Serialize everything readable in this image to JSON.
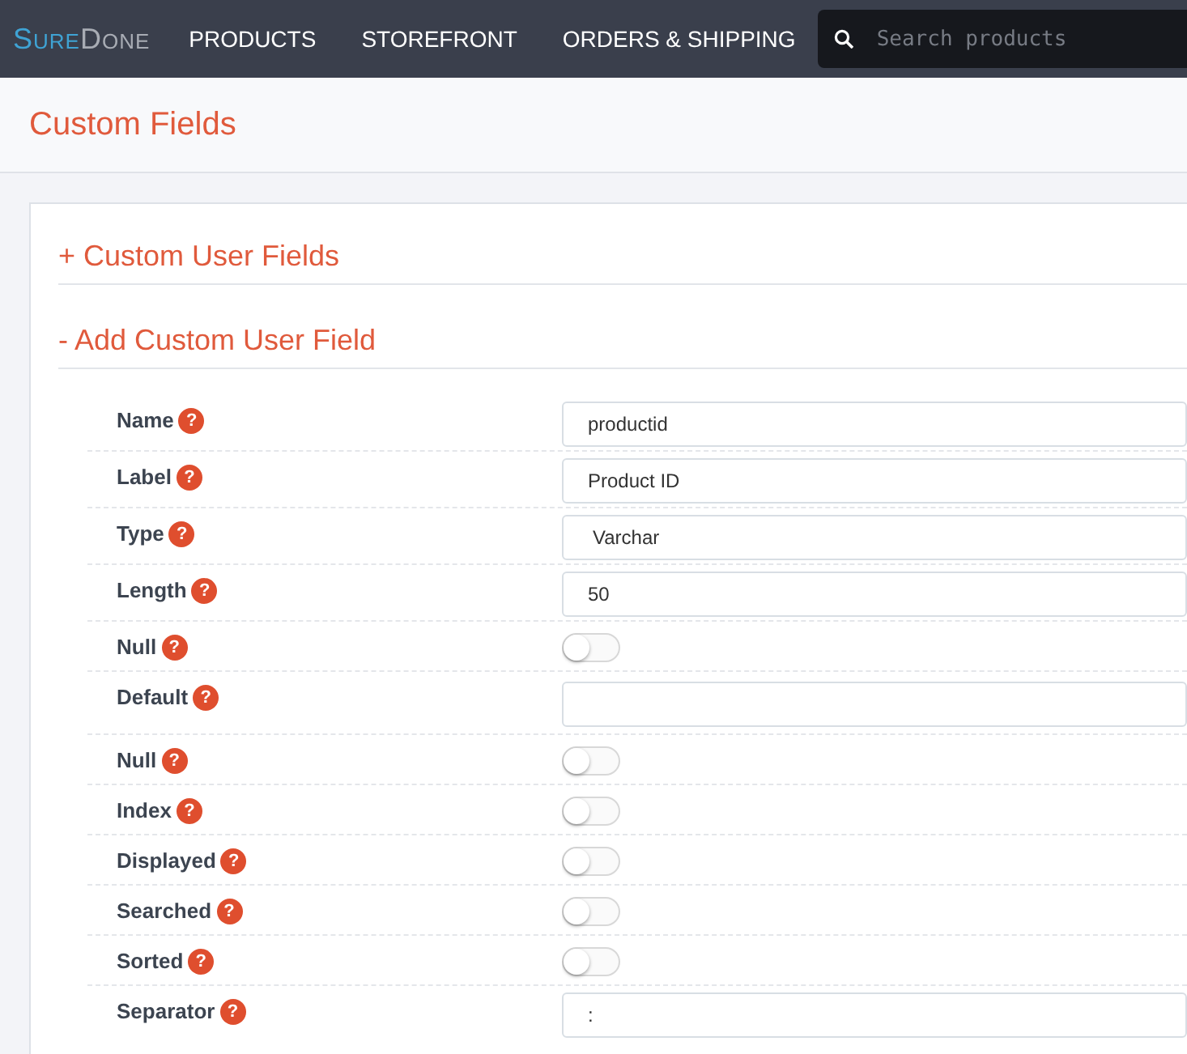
{
  "navbar": {
    "logo": [
      "Sure",
      "Done"
    ],
    "menu": [
      "PRODUCTS",
      "STOREFRONT",
      "ORDERS & SHIPPING"
    ],
    "search": {
      "placeholder": "Search products"
    }
  },
  "page_title": "Custom Fields",
  "sections": [
    {
      "marker": "+",
      "title": "Custom User Fields"
    },
    {
      "marker": "-",
      "title": "Add Custom User Field"
    }
  ],
  "fields": [
    {
      "kind": "input",
      "label": "Name",
      "help": "?",
      "value": "productid"
    },
    {
      "kind": "input",
      "label": "Label",
      "help": "?",
      "value": "Product ID"
    },
    {
      "kind": "select",
      "label": "Type",
      "help": "?",
      "value": "Varchar"
    },
    {
      "kind": "input",
      "label": "Length",
      "help": "?",
      "value": "50"
    },
    {
      "kind": "toggle",
      "label": "Null",
      "help": "?",
      "on": false
    },
    {
      "kind": "input",
      "label": "Default",
      "help": "?"
    },
    {
      "kind": "toggle",
      "label": "Null",
      "help": "?",
      "on": false
    },
    {
      "kind": "toggle",
      "label": "Index",
      "help": "?",
      "on": false
    },
    {
      "kind": "toggle",
      "label": "Displayed",
      "help": "?",
      "on": false
    },
    {
      "kind": "toggle",
      "label": "Searched",
      "help": "?",
      "on": false
    },
    {
      "kind": "toggle",
      "label": "Sorted",
      "help": "?",
      "on": false
    },
    {
      "kind": "input",
      "label": "Separator",
      "help": "?",
      "value": ":"
    }
  ]
}
